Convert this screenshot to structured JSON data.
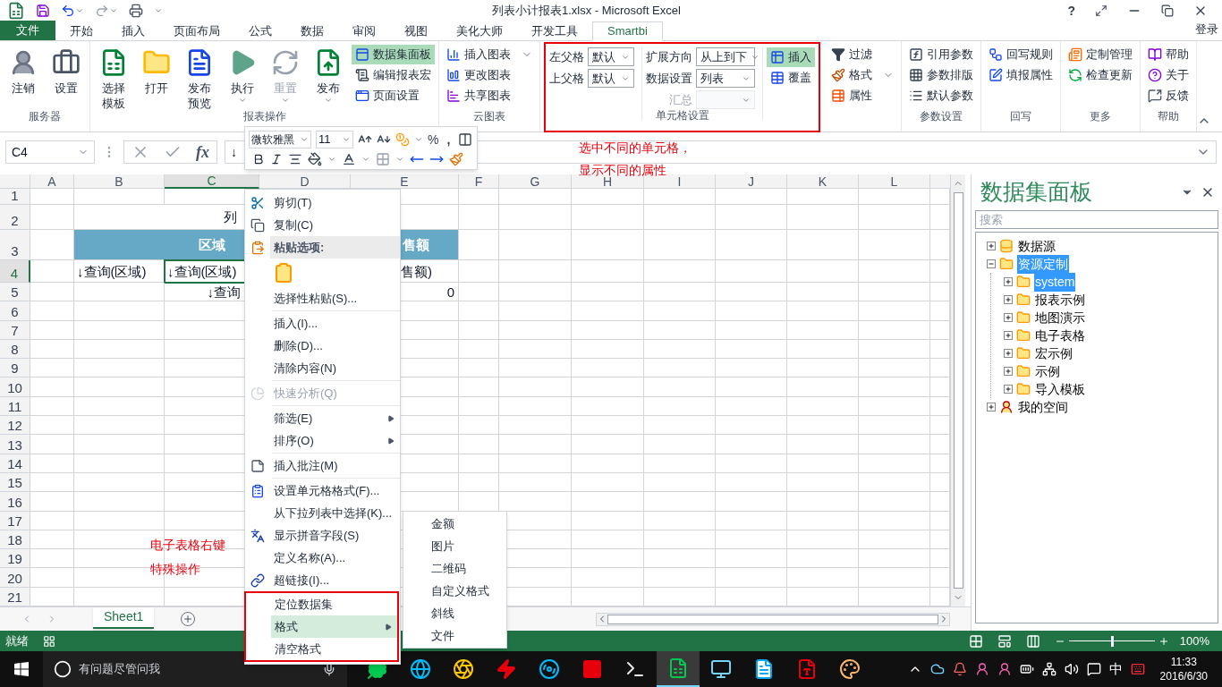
{
  "title_bar": {
    "title": "列表小计报表1.xlsx - Microsoft Excel",
    "help": "?"
  },
  "ribbon_tabs": [
    {
      "label": "文件",
      "kind": "file",
      "selected": false
    },
    {
      "label": "开始",
      "kind": "tab",
      "selected": false
    },
    {
      "label": "插入",
      "kind": "tab",
      "selected": false
    },
    {
      "label": "页面布局",
      "kind": "tab",
      "selected": false
    },
    {
      "label": "公式",
      "kind": "tab",
      "selected": false
    },
    {
      "label": "数据",
      "kind": "tab",
      "selected": false
    },
    {
      "label": "审阅",
      "kind": "tab",
      "selected": false
    },
    {
      "label": "视图",
      "kind": "tab",
      "selected": false
    },
    {
      "label": "美化大师",
      "kind": "tab",
      "selected": false
    },
    {
      "label": "开发工具",
      "kind": "tab",
      "selected": false
    },
    {
      "label": "Smartbi",
      "kind": "tab",
      "selected": true
    }
  ],
  "sign_in": "登录",
  "ribbon_groups": [
    {
      "label": "服务器",
      "highlighted": false,
      "columns": [
        [
          {
            "kind": "large",
            "label": "注销",
            "dropdown": false,
            "disabled": false
          }
        ],
        [
          {
            "kind": "large",
            "label": "设置",
            "dropdown": false,
            "disabled": false
          }
        ]
      ]
    },
    {
      "label": "报表操作",
      "highlighted": false,
      "columns": [
        [
          {
            "kind": "large",
            "label": "选择模板",
            "dropdown": false,
            "disabled": false
          }
        ],
        [
          {
            "kind": "large",
            "label": "打开",
            "dropdown": false,
            "disabled": false
          }
        ],
        [
          {
            "kind": "large",
            "label": "发布预览",
            "dropdown": false,
            "disabled": false
          }
        ],
        [
          {
            "kind": "large",
            "label": "执行",
            "dropdown": true,
            "disabled": false
          }
        ],
        [
          {
            "kind": "large",
            "label": "重置",
            "dropdown": true,
            "disabled": true
          }
        ],
        [
          {
            "kind": "large",
            "label": "发布",
            "dropdown": true,
            "disabled": false
          }
        ],
        [
          {
            "kind": "small",
            "label": "数据集面板",
            "selected": true,
            "dropdown": false
          },
          {
            "kind": "small",
            "label": "编辑报表宏",
            "selected": false,
            "dropdown": false
          },
          {
            "kind": "small",
            "label": "页面设置",
            "selected": false,
            "dropdown": false
          }
        ]
      ]
    },
    {
      "label": "云图表",
      "highlighted": false,
      "columns": [
        [
          {
            "kind": "small",
            "label": "插入图表",
            "selected": false,
            "dropdown": true
          },
          {
            "kind": "small",
            "label": "更改图表",
            "selected": false,
            "dropdown": false
          },
          {
            "kind": "small",
            "label": "共享图表",
            "selected": false,
            "dropdown": false
          }
        ]
      ]
    },
    {
      "label": "单元格设置",
      "highlighted": true,
      "columns": [
        [
          {
            "kind": "select",
            "label": "左父格",
            "value": "默认",
            "disabled": false
          },
          {
            "kind": "select",
            "label": "上父格",
            "value": "默认",
            "disabled": false
          }
        ],
        [
          {
            "kind": "select",
            "label": "扩展方向",
            "value": "从上到下",
            "disabled": false
          },
          {
            "kind": "select",
            "label": "数据设置",
            "value": "列表",
            "disabled": false
          },
          {
            "kind": "select",
            "label": "汇总",
            "disabled": true
          }
        ],
        [
          {
            "kind": "small",
            "label": "插入",
            "selected": true,
            "dropdown": false
          },
          {
            "kind": "small",
            "label": "覆盖",
            "selected": false,
            "dropdown": false
          }
        ]
      ]
    },
    {
      "highlighted": false,
      "columns": [
        [
          {
            "kind": "small",
            "label": "过滤",
            "selected": false,
            "dropdown": false
          },
          {
            "kind": "small",
            "label": "格式",
            "selected": false,
            "dropdown": true
          },
          {
            "kind": "small",
            "label": "属性",
            "selected": false,
            "dropdown": false
          }
        ]
      ]
    },
    {
      "label": "参数设置",
      "highlighted": false,
      "columns": [
        [
          {
            "kind": "small",
            "label": "引用参数",
            "selected": false,
            "dropdown": false
          },
          {
            "kind": "small",
            "label": "参数排版",
            "selected": false,
            "dropdown": false
          },
          {
            "kind": "small",
            "label": "默认参数",
            "selected": false,
            "dropdown": false
          }
        ]
      ]
    },
    {
      "label": "回写",
      "highlighted": false,
      "columns": [
        [
          {
            "kind": "small",
            "label": "回写规则",
            "selected": false,
            "dropdown": false
          },
          {
            "kind": "small",
            "label": "填报属性",
            "selected": false,
            "dropdown": false
          }
        ]
      ]
    },
    {
      "label": "更多",
      "highlighted": false,
      "columns": [
        [
          {
            "kind": "small",
            "label": "定制管理",
            "selected": false,
            "dropdown": false
          },
          {
            "kind": "small",
            "label": "检查更新",
            "selected": false,
            "dropdown": false
          }
        ]
      ]
    },
    {
      "label": "帮助",
      "highlighted": false,
      "columns": [
        [
          {
            "kind": "small",
            "label": "帮助",
            "selected": false,
            "dropdown": false
          },
          {
            "kind": "small",
            "label": "关于",
            "selected": false,
            "dropdown": false
          },
          {
            "kind": "small",
            "label": "反馈",
            "selected": false,
            "dropdown": false
          }
        ]
      ]
    }
  ],
  "formula_bar": {
    "name_box": "C4",
    "fx": "fx",
    "formula": "↓"
  },
  "mini_toolbar": {
    "font_field": "微软雅黑",
    "size_field": "11",
    "percent": "%",
    "comma": ","
  },
  "notes": [
    "选中不同的单元格，",
    "显示不同的属性",
    "电子表格右键",
    "特殊操作"
  ],
  "sheet": {
    "columns": [
      {
        "label": "A",
        "selected": false
      },
      {
        "label": "B",
        "selected": false
      },
      {
        "label": "C",
        "selected": true
      },
      {
        "label": "D",
        "selected": false
      },
      {
        "label": "E",
        "selected": false
      },
      {
        "label": "F",
        "selected": false
      },
      {
        "label": "G",
        "selected": false
      },
      {
        "label": "H",
        "selected": false
      },
      {
        "label": "I",
        "selected": false
      },
      {
        "label": "J",
        "selected": false
      },
      {
        "label": "K",
        "selected": false
      },
      {
        "label": "L",
        "selected": false
      }
    ],
    "rows": [
      {
        "number": "1",
        "selected": false
      },
      {
        "number": "2",
        "selected": false,
        "cells": [
          {
            "text": "列",
            "kind": "title",
            "selected": false
          }
        ]
      },
      {
        "number": "3",
        "selected": false,
        "cells": [
          {
            "text": "区域",
            "kind": "header",
            "selected": false
          },
          {
            "text": "售额",
            "kind": "header-partial",
            "selected": false
          }
        ]
      },
      {
        "number": "4",
        "selected": true,
        "cells": [
          {
            "text": "↓查询(区域)",
            "kind": "field",
            "selected": false
          },
          {
            "text": "↓查询(区域)",
            "kind": "field",
            "selected": true
          },
          {
            "text": "售额)",
            "kind": "field-partial",
            "selected": false
          }
        ]
      },
      {
        "number": "5",
        "selected": false,
        "cells": [
          {
            "text": "↓查询",
            "kind": "field-cut",
            "selected": false
          },
          {
            "text": "0",
            "kind": "number",
            "selected": false
          }
        ]
      },
      {
        "number": "6",
        "selected": false
      },
      {
        "number": "7",
        "selected": false
      },
      {
        "number": "8",
        "selected": false
      },
      {
        "number": "9",
        "selected": false
      },
      {
        "number": "10",
        "selected": false
      },
      {
        "number": "11",
        "selected": false
      },
      {
        "number": "12",
        "selected": false
      },
      {
        "number": "13",
        "selected": false
      },
      {
        "number": "14",
        "selected": false
      },
      {
        "number": "15",
        "selected": false
      },
      {
        "number": "16",
        "selected": false
      },
      {
        "number": "17",
        "selected": false
      },
      {
        "number": "18",
        "selected": false
      },
      {
        "number": "19",
        "selected": false
      },
      {
        "number": "20",
        "selected": false
      },
      {
        "number": "21",
        "selected": false
      }
    ]
  },
  "context_menu": {
    "sections": [
      {
        "highlighted": false,
        "items": [
          {
            "kind": "item",
            "label": "剪切(T)",
            "disabled": false,
            "selected": false,
            "submenu": false
          },
          {
            "kind": "item",
            "label": "复制(C)",
            "disabled": false,
            "selected": false,
            "submenu": false
          },
          {
            "kind": "heading",
            "label": "粘贴选项:"
          },
          {
            "kind": "paste-option"
          },
          {
            "kind": "item",
            "label": "选择性粘贴(S)...",
            "disabled": false,
            "selected": false,
            "submenu": false
          }
        ]
      },
      {
        "highlighted": false,
        "items": [
          {
            "kind": "item",
            "label": "插入(I)...",
            "disabled": false,
            "selected": false,
            "submenu": false
          },
          {
            "kind": "item",
            "label": "删除(D)...",
            "disabled": false,
            "selected": false,
            "submenu": false
          },
          {
            "kind": "item",
            "label": "清除内容(N)",
            "disabled": false,
            "selected": false,
            "submenu": false
          }
        ]
      },
      {
        "highlighted": false,
        "items": [
          {
            "kind": "item",
            "label": "快速分析(Q)",
            "disabled": true,
            "selected": false,
            "submenu": false
          }
        ]
      },
      {
        "highlighted": false,
        "items": [
          {
            "kind": "item",
            "label": "筛选(E)",
            "disabled": false,
            "selected": false,
            "submenu": true
          },
          {
            "kind": "item",
            "label": "排序(O)",
            "disabled": false,
            "selected": false,
            "submenu": true
          }
        ]
      },
      {
        "highlighted": false,
        "items": [
          {
            "kind": "item",
            "label": "插入批注(M)",
            "disabled": false,
            "selected": false,
            "submenu": false
          }
        ]
      },
      {
        "highlighted": false,
        "items": [
          {
            "kind": "item",
            "label": "设置单元格格式(F)...",
            "disabled": false,
            "selected": false,
            "submenu": false
          },
          {
            "kind": "item",
            "label": "从下拉列表中选择(K)...",
            "disabled": false,
            "selected": false,
            "submenu": false
          },
          {
            "kind": "item",
            "label": "显示拼音字段(S)",
            "disabled": false,
            "selected": false,
            "submenu": false
          },
          {
            "kind": "item",
            "label": "定义名称(A)...",
            "disabled": false,
            "selected": false,
            "submenu": false
          },
          {
            "kind": "item",
            "label": "超链接(I)...",
            "disabled": false,
            "selected": false,
            "submenu": false
          }
        ]
      },
      {
        "highlighted": true,
        "items": [
          {
            "kind": "item",
            "label": "定位数据集",
            "disabled": false,
            "selected": false,
            "submenu": false
          },
          {
            "kind": "item",
            "label": "格式",
            "disabled": false,
            "selected": true,
            "submenu": true
          },
          {
            "kind": "item",
            "label": "清空格式",
            "disabled": false,
            "selected": false,
            "submenu": false
          }
        ]
      }
    ],
    "format_submenu": [
      "金额",
      "图片",
      "二维码",
      "自定义格式",
      "斜线",
      "文件"
    ]
  },
  "dataset_panel": {
    "title": "数据集面板",
    "search_placeholder": "搜索",
    "tree": [
      {
        "label": "数据源",
        "kind": "datasource",
        "expanded": false,
        "selected": false
      },
      {
        "label": "资源定制",
        "kind": "folder",
        "expanded": true,
        "selected": true,
        "children": [
          {
            "label": "system",
            "kind": "folder",
            "expanded": false,
            "selected": true
          },
          {
            "label": "报表示例",
            "kind": "folder",
            "expanded": false,
            "selected": false
          },
          {
            "label": "地图演示",
            "kind": "folder",
            "expanded": false,
            "selected": false
          },
          {
            "label": "电子表格",
            "kind": "folder",
            "expanded": false,
            "selected": false
          },
          {
            "label": "宏示例",
            "kind": "folder",
            "expanded": false,
            "selected": false
          },
          {
            "label": "示例",
            "kind": "folder",
            "expanded": false,
            "selected": false
          },
          {
            "label": "导入模板",
            "kind": "folder",
            "expanded": false,
            "selected": false
          }
        ]
      },
      {
        "label": "我的空间",
        "kind": "user",
        "expanded": false,
        "selected": false
      }
    ]
  },
  "sheet_tabs": [
    {
      "label": "Sheet1",
      "selected": true
    }
  ],
  "status_bar": {
    "text": "就绪",
    "zoom_slider": {
      "level": 0.5,
      "reading": "100%"
    }
  },
  "taskbar": {
    "search_placeholder": "有问题尽管问我",
    "ime": "中",
    "time": "11:33",
    "date": "2016/6/30",
    "apps": [
      {
        "selected": false
      },
      {
        "selected": false
      },
      {
        "selected": false
      },
      {
        "selected": false
      },
      {
        "selected": false
      },
      {
        "selected": false
      },
      {
        "selected": false
      },
      {
        "selected": true
      },
      {
        "selected": false
      },
      {
        "selected": false
      },
      {
        "selected": false
      },
      {
        "selected": false
      }
    ]
  }
}
